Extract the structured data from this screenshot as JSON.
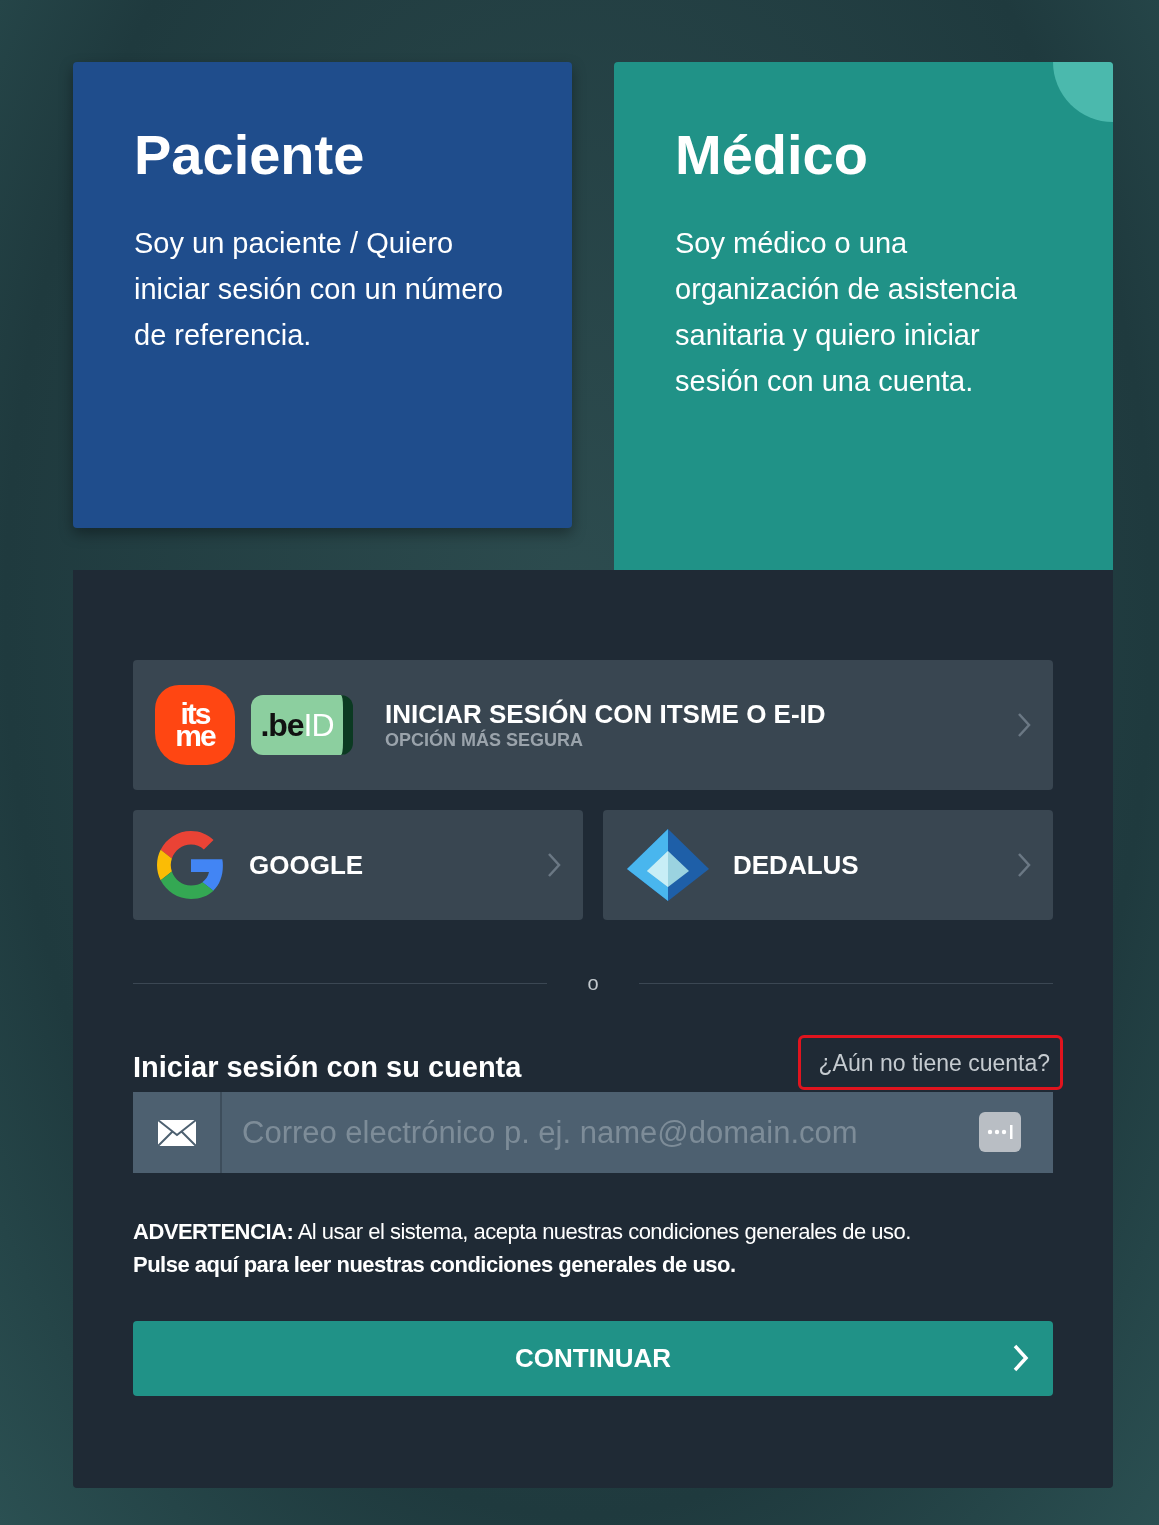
{
  "role_tabs": [
    {
      "title": "Paciente",
      "description": "Soy un paciente / Quiero iniciar sesión con un número de referencia.",
      "selected": false
    },
    {
      "title": "Médico",
      "description": "Soy médico o una organización de asistencia sanitaria y quiero iniciar sesión con una cuenta.",
      "selected": true
    }
  ],
  "providers": [
    {
      "kind": "itsme_eid",
      "label": "INICIAR SESIÓN CON ITSME O E-ID",
      "sublabel": "OPCIÓN MÁS SEGURA",
      "itsme_logo": [
        "its",
        "me"
      ],
      "beid_logo": [
        ".be",
        "ID"
      ]
    },
    {
      "kind": "google",
      "label": "GOOGLE"
    },
    {
      "kind": "dedalus",
      "label": "DEDALUS"
    }
  ],
  "separator": "o",
  "account_login": {
    "heading": "Iniciar sesión con su cuenta",
    "signup_link": {
      "label": "¿Aún no tiene cuenta?",
      "highlighted": true
    },
    "email_field": {
      "placeholder": "Correo electrónico p. ej. name@domain.com"
    }
  },
  "warning": {
    "text": "**ADVERTENCIA:** Al usar el sistema, acepta nuestras condiciones generales de uso.",
    "link": "Pulse aquí para leer nuestras condiciones generales de uso."
  },
  "continue_button": "CONTINUAR"
}
